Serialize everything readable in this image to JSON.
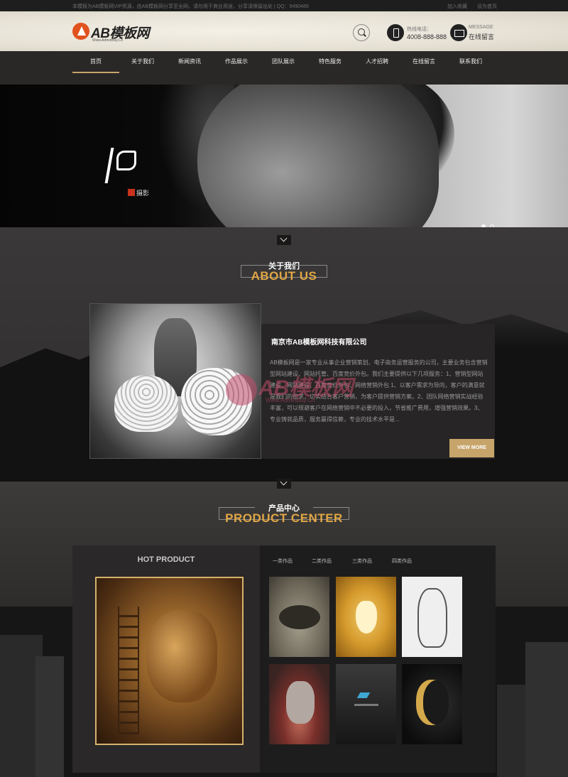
{
  "topbar": {
    "notice": "本模板为AB模板网VIP资源，由AB模板网分享至全网，请勿用于商业用途，分享请保留出处 | QQ：9490489",
    "links": [
      "加入收藏",
      "设为首页"
    ]
  },
  "header": {
    "logo_text": "AB模板网",
    "logo_sub": "Www.AdminBuy.Cn",
    "phone_label": "热线电话：",
    "phone_value": "4008-888-888",
    "msg_label": "MESSAGE",
    "msg_value": "在线留言"
  },
  "nav": {
    "items": [
      "首页",
      "关于我们",
      "新闻资讯",
      "作品展示",
      "团队展示",
      "特色服务",
      "人才招聘",
      "在线留言",
      "联系我们"
    ],
    "active_index": 0
  },
  "banner": {
    "tagline": "摄影",
    "slides": 2,
    "active_slide": 0
  },
  "about": {
    "title_cn": "关于我们",
    "title_en": "ABOUT US",
    "company": "南京市AB模板网科技有限公司",
    "description": "AB模板网是一家专业从事企业营销策划、电子商务运营服务的公司，主要业务包含营销型网站建设、网站托管、百度竞价外包。我们主要提供以下几项服务：1、营销型网站建设、网站建设、百度竞价外包、网络营销外包 1、以客户需求为导向，客户的满意就是我们的追求，切实结合客户营销，为客户提供营销方案。2、团队网络营销实战经验丰富，可以规避客户在网络营销中不必要的投入，节省推广费用，增强营销效果。3、专业铸就品质，服务赢得信赖，专业的技术水平是...",
    "watermark_text": "AB模板网",
    "watermark_sub": "Www.AdminBuy.Cn",
    "view_more": "VIEW MORE"
  },
  "products": {
    "title_cn": "产品中心",
    "title_en": "PRODUCT CENTER",
    "hot_title": "HOT PRODUCT",
    "tabs": [
      "一类作品",
      "二类作品",
      "三类作品",
      "四类作品"
    ]
  },
  "colors": {
    "accent": "#c7a56a",
    "title_gold": "#e1a745",
    "logo_orange": "#e1521e"
  }
}
